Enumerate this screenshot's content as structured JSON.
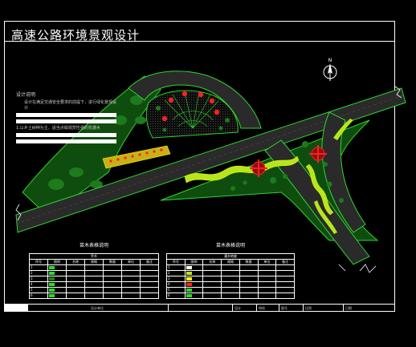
{
  "drawing": {
    "title": "高速公路环境景观设计"
  },
  "design_notes": {
    "heading": "设计说明",
    "line1": "设计在满足交通安全要求的前提下，进行绿化景观设计",
    "line2": "1.以乡土树种为主，适当点缀观赏性强的花灌木"
  },
  "north_arrow": {
    "letter": "N"
  },
  "tree_table": {
    "title": "苗木表格说明",
    "sub_header": "乔木",
    "headers": [
      "序号",
      "图例",
      "名称",
      "规格",
      "数量",
      "单位",
      "备注"
    ],
    "rows": [
      [
        "1",
        "",
        "",
        "",
        "",
        "",
        ""
      ],
      [
        "2",
        "",
        "",
        "",
        "",
        "",
        ""
      ],
      [
        "3",
        "",
        "",
        "",
        "",
        "",
        ""
      ],
      [
        "4",
        "",
        "",
        "",
        "",
        "",
        ""
      ],
      [
        "5",
        "",
        "",
        "",
        "",
        "",
        ""
      ],
      [
        "6",
        "",
        "",
        "",
        "",
        "",
        ""
      ]
    ]
  },
  "shrub_table": {
    "title": "苗木表格说明",
    "sub_header": "灌木地被",
    "headers": [
      "序号",
      "图例",
      "名称",
      "规格",
      "数量",
      "单位",
      "备注"
    ],
    "rows": [
      [
        "1",
        "",
        "",
        "",
        "",
        "",
        ""
      ],
      [
        "2",
        "",
        "",
        "",
        "",
        "",
        ""
      ],
      [
        "3",
        "",
        "",
        "",
        "",
        "",
        ""
      ],
      [
        "4",
        "",
        "",
        "",
        "",
        "",
        ""
      ],
      [
        "5",
        "",
        "",
        "",
        "",
        "",
        ""
      ],
      [
        "6",
        "",
        "",
        "",
        "",
        "",
        ""
      ]
    ]
  },
  "footer": {
    "cells": [
      "",
      "设计单位",
      "",
      "设计",
      "审核",
      "图号",
      "比例",
      "日期"
    ]
  },
  "colors": {
    "green_line": "#2fd52f",
    "road": "#2a2a2a",
    "lawn": "#1a6b1a",
    "yellow_green": "#b5e61d",
    "red": "#ff2020",
    "yellow": "#ffff00"
  }
}
